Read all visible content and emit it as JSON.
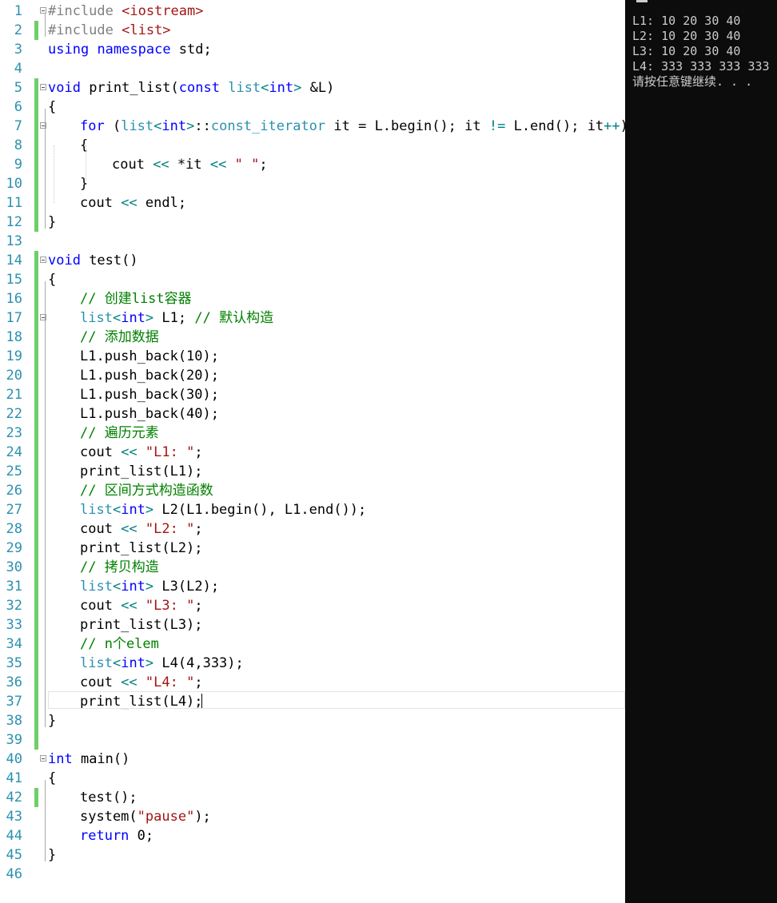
{
  "editor": {
    "line_numbers": [
      "1",
      "2",
      "3",
      "4",
      "5",
      "6",
      "7",
      "8",
      "9",
      "10",
      "11",
      "12",
      "13",
      "14",
      "15",
      "16",
      "17",
      "18",
      "19",
      "20",
      "21",
      "22",
      "23",
      "24",
      "25",
      "26",
      "27",
      "28",
      "29",
      "30",
      "31",
      "32",
      "33",
      "34",
      "35",
      "36",
      "37",
      "38",
      "39",
      "40",
      "41",
      "42",
      "43",
      "44",
      "45",
      "46"
    ],
    "lines": [
      [
        {
          "t": "#include ",
          "c": "pp"
        },
        {
          "t": "<iostream>",
          "c": "str"
        }
      ],
      [
        {
          "t": "#include ",
          "c": "pp"
        },
        {
          "t": "<list>",
          "c": "str"
        }
      ],
      [
        {
          "t": "using",
          "c": "kw"
        },
        {
          "t": " ",
          "c": ""
        },
        {
          "t": "namespace",
          "c": "kw"
        },
        {
          "t": " std;",
          "c": ""
        }
      ],
      [],
      [
        {
          "t": "void",
          "c": "kw"
        },
        {
          "t": " print_list(",
          "c": ""
        },
        {
          "t": "const",
          "c": "kw"
        },
        {
          "t": " ",
          "c": ""
        },
        {
          "t": "list",
          "c": "ty"
        },
        {
          "t": "<",
          "c": "op"
        },
        {
          "t": "int",
          "c": "kw"
        },
        {
          "t": ">",
          "c": "op"
        },
        {
          "t": " &L)",
          "c": ""
        }
      ],
      [
        {
          "t": "{",
          "c": ""
        }
      ],
      [
        {
          "t": "for",
          "c": "kw"
        },
        {
          "t": " (",
          "c": ""
        },
        {
          "t": "list",
          "c": "ty"
        },
        {
          "t": "<",
          "c": "op"
        },
        {
          "t": "int",
          "c": "kw"
        },
        {
          "t": ">",
          "c": "op"
        },
        {
          "t": "::",
          "c": ""
        },
        {
          "t": "const_iterator",
          "c": "ty"
        },
        {
          "t": " it = L.begin(); it ",
          "c": ""
        },
        {
          "t": "!=",
          "c": "op"
        },
        {
          "t": " L.end(); it",
          "c": ""
        },
        {
          "t": "++",
          "c": "op"
        },
        {
          "t": ")",
          "c": ""
        }
      ],
      [
        {
          "t": "{",
          "c": ""
        }
      ],
      [
        {
          "t": "cout ",
          "c": ""
        },
        {
          "t": "<<",
          "c": "op"
        },
        {
          "t": " *it ",
          "c": ""
        },
        {
          "t": "<<",
          "c": "op"
        },
        {
          "t": " ",
          "c": ""
        },
        {
          "t": "\" \"",
          "c": "str"
        },
        {
          "t": ";",
          "c": ""
        }
      ],
      [
        {
          "t": "}",
          "c": ""
        }
      ],
      [
        {
          "t": "cout ",
          "c": ""
        },
        {
          "t": "<<",
          "c": "op"
        },
        {
          "t": " endl;",
          "c": ""
        }
      ],
      [
        {
          "t": "}",
          "c": ""
        }
      ],
      [],
      [
        {
          "t": "void",
          "c": "kw"
        },
        {
          "t": " test()",
          "c": ""
        }
      ],
      [
        {
          "t": "{",
          "c": ""
        }
      ],
      [
        {
          "t": "// 创建list容器",
          "c": "cm"
        }
      ],
      [
        {
          "t": "list",
          "c": "ty"
        },
        {
          "t": "<",
          "c": "op"
        },
        {
          "t": "int",
          "c": "kw"
        },
        {
          "t": ">",
          "c": "op"
        },
        {
          "t": " L1; ",
          "c": ""
        },
        {
          "t": "// 默认构造",
          "c": "cm"
        }
      ],
      [
        {
          "t": "// 添加数据",
          "c": "cm"
        }
      ],
      [
        {
          "t": "L1.push_back(10);",
          "c": ""
        }
      ],
      [
        {
          "t": "L1.push_back(20);",
          "c": ""
        }
      ],
      [
        {
          "t": "L1.push_back(30);",
          "c": ""
        }
      ],
      [
        {
          "t": "L1.push_back(40);",
          "c": ""
        }
      ],
      [
        {
          "t": "// 遍历元素",
          "c": "cm"
        }
      ],
      [
        {
          "t": "cout ",
          "c": ""
        },
        {
          "t": "<<",
          "c": "op"
        },
        {
          "t": " ",
          "c": ""
        },
        {
          "t": "\"L1: \"",
          "c": "str"
        },
        {
          "t": ";",
          "c": ""
        }
      ],
      [
        {
          "t": "print_list(L1);",
          "c": ""
        }
      ],
      [
        {
          "t": "// 区间方式构造函数",
          "c": "cm"
        }
      ],
      [
        {
          "t": "list",
          "c": "ty"
        },
        {
          "t": "<",
          "c": "op"
        },
        {
          "t": "int",
          "c": "kw"
        },
        {
          "t": ">",
          "c": "op"
        },
        {
          "t": " L2(L1.begin(), L1.end());",
          "c": ""
        }
      ],
      [
        {
          "t": "cout ",
          "c": ""
        },
        {
          "t": "<<",
          "c": "op"
        },
        {
          "t": " ",
          "c": ""
        },
        {
          "t": "\"L2: \"",
          "c": "str"
        },
        {
          "t": ";",
          "c": ""
        }
      ],
      [
        {
          "t": "print_list(L2);",
          "c": ""
        }
      ],
      [
        {
          "t": "// 拷贝构造",
          "c": "cm"
        }
      ],
      [
        {
          "t": "list",
          "c": "ty"
        },
        {
          "t": "<",
          "c": "op"
        },
        {
          "t": "int",
          "c": "kw"
        },
        {
          "t": ">",
          "c": "op"
        },
        {
          "t": " L3(L2);",
          "c": ""
        }
      ],
      [
        {
          "t": "cout ",
          "c": ""
        },
        {
          "t": "<<",
          "c": "op"
        },
        {
          "t": " ",
          "c": ""
        },
        {
          "t": "\"L3: \"",
          "c": "str"
        },
        {
          "t": ";",
          "c": ""
        }
      ],
      [
        {
          "t": "print_list(L3);",
          "c": ""
        }
      ],
      [
        {
          "t": "// n个elem",
          "c": "cm"
        }
      ],
      [
        {
          "t": "list",
          "c": "ty"
        },
        {
          "t": "<",
          "c": "op"
        },
        {
          "t": "int",
          "c": "kw"
        },
        {
          "t": ">",
          "c": "op"
        },
        {
          "t": " L4(4,333);",
          "c": ""
        }
      ],
      [
        {
          "t": "cout ",
          "c": ""
        },
        {
          "t": "<<",
          "c": "op"
        },
        {
          "t": " ",
          "c": ""
        },
        {
          "t": "\"L4: \"",
          "c": "str"
        },
        {
          "t": ";",
          "c": ""
        }
      ],
      [
        {
          "t": "print_list(L4);",
          "c": ""
        }
      ],
      [
        {
          "t": "}",
          "c": ""
        }
      ],
      [],
      [
        {
          "t": "int",
          "c": "kw"
        },
        {
          "t": " main()",
          "c": ""
        }
      ],
      [
        {
          "t": "{",
          "c": ""
        }
      ],
      [
        {
          "t": "test();",
          "c": ""
        }
      ],
      [
        {
          "t": "system(",
          "c": ""
        },
        {
          "t": "\"pause\"",
          "c": "str"
        },
        {
          "t": ");",
          "c": ""
        }
      ],
      [
        {
          "t": "return",
          "c": "kw"
        },
        {
          "t": " 0;",
          "c": ""
        }
      ],
      [
        {
          "t": "}",
          "c": ""
        }
      ],
      []
    ],
    "current_line": "37"
  },
  "console": {
    "lines": [
      "L1: 10 20 30 40",
      "L2: 10 20 30 40",
      "L3: 10 20 30 40",
      "L4: 333 333 333 333",
      "请按任意键继续. . ."
    ]
  },
  "colors": {
    "keyword": "#0000ff",
    "type": "#2b91af",
    "string": "#a31515",
    "comment": "#008000",
    "operator": "#008080",
    "line_number": "#2b91af",
    "change_bar": "#6fcf67",
    "console_bg": "#0c0c0c",
    "console_text": "#cccccc"
  }
}
